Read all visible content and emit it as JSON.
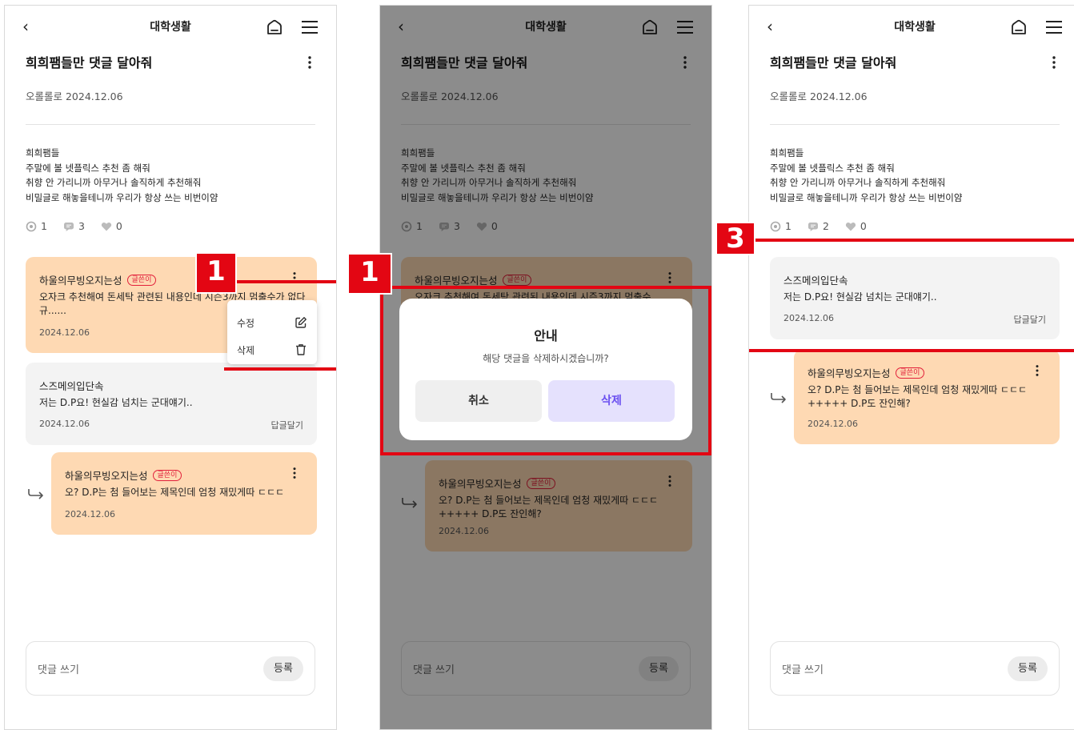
{
  "screens": [
    {
      "topbar": {
        "back": "‹",
        "title": "대학생활"
      },
      "post": {
        "title": "희희팸들만 댓글 달아줘",
        "meta": "오롤롤로 2024.12.06",
        "body": [
          "희희팸들",
          "주말에 볼 넷플릭스 추천 좀 해줘",
          "취향 안 가리니까 아무거나 솔직하게 추천해줘",
          "비밀글로 해놓을테니까 우리가 항상 쓰는 비번이얌"
        ],
        "views": "1",
        "comments": "3",
        "likes": "0"
      },
      "comments": [
        {
          "author": "하울의무빙오지는성",
          "badge": "글쓴이",
          "text": "오자크 추천해여 돈세탁 관련된 내용인데 시즌3까지 멈출수가 없다규......",
          "date": "2024.12.06"
        },
        {
          "author": "스즈메의입단속",
          "text": "저는 D.P요! 현실감 넘치는 군대얘기..",
          "date": "2024.12.06",
          "reply": "답글달기"
        },
        {
          "author": "하울의무빙오지는성",
          "badge": "글쓴이",
          "text": "오? D.P는 첨 들어보는 제목인데 엄청 재밌게따 ㄷㄷㄷ",
          "date": "2024.12.06"
        }
      ],
      "context_menu": {
        "edit": "수정",
        "delete": "삭제"
      },
      "input": {
        "placeholder": "댓글 쓰기",
        "submit": "등록"
      },
      "marker": "1"
    },
    {
      "topbar": {
        "back": "‹",
        "title": "대학생활"
      },
      "post": {
        "title": "희희팸들만 댓글 달아줘",
        "meta": "오롤롤로 2024.12.06",
        "body": [
          "희희팸들",
          "주말에 볼 넷플릭스 추천 좀 해줘",
          "취향 안 가리니까 아무거나 솔직하게 추천해줘",
          "비밀글로 해놓을테니까 우리가 항상 쓰는 비번이얌"
        ],
        "views": "1",
        "comments": "3",
        "likes": "0"
      },
      "comments": [
        {
          "author": "하울의무빙오지는성",
          "badge": "글쓴이",
          "text": "오자크 추천해여 돈세탁 관련된 내용인데 시즌3까지 멈출수",
          "date": ""
        },
        {
          "author": "하울의무빙오지는성",
          "badge": "글쓴이",
          "text": "오? D.P는 첨 들어보는 제목인데 엄청 재밌게따 ㄷㄷㄷ +++++ D.P도 잔인해?",
          "date": "2024.12.06"
        }
      ],
      "dialog": {
        "title": "안내",
        "message": "해당 댓글을 삭제하시겠습니까?",
        "cancel": "취소",
        "confirm": "삭제"
      },
      "input": {
        "placeholder": "댓글 쓰기",
        "submit": "등록"
      },
      "marker": "1"
    },
    {
      "topbar": {
        "back": "‹",
        "title": "대학생활"
      },
      "post": {
        "title": "희희팸들만 댓글 달아줘",
        "meta": "오롤롤로 2024.12.06",
        "body": [
          "희희팸들",
          "주말에 볼 넷플릭스 추천 좀 해줘",
          "취향 안 가리니까 아무거나 솔직하게 추천해줘",
          "비밀글로 해놓을테니까 우리가 항상 쓰는 비번이얌"
        ],
        "views": "1",
        "comments": "2",
        "likes": "0"
      },
      "comments": [
        {
          "author": "스즈메의입단속",
          "text": "저는 D.P요! 현실감 넘치는 군대얘기..",
          "date": "2024.12.06",
          "reply": "답글달기"
        },
        {
          "author": "하울의무빙오지는성",
          "badge": "글쓴이",
          "text": "오? D.P는 첨 들어보는 제목인데 엄청 재밌게따 ㄷㄷㄷ +++++ D.P도 잔인해?",
          "date": "2024.12.06"
        }
      ],
      "input": {
        "placeholder": "댓글 쓰기",
        "submit": "등록"
      },
      "marker": "3"
    }
  ],
  "colors": {
    "highlight": "#e30613",
    "comment_orange": "#fed9b3",
    "comment_gray": "#f3f3f3",
    "badge": "#e2203b",
    "confirm_text": "#6a4ff0"
  },
  "icons": [
    "back-arrow-icon",
    "home-icon",
    "hamburger-menu-icon",
    "more-vertical-icon",
    "eye-icon",
    "comment-icon",
    "heart-icon",
    "edit-icon",
    "trash-icon",
    "reply-arrow-icon"
  ]
}
